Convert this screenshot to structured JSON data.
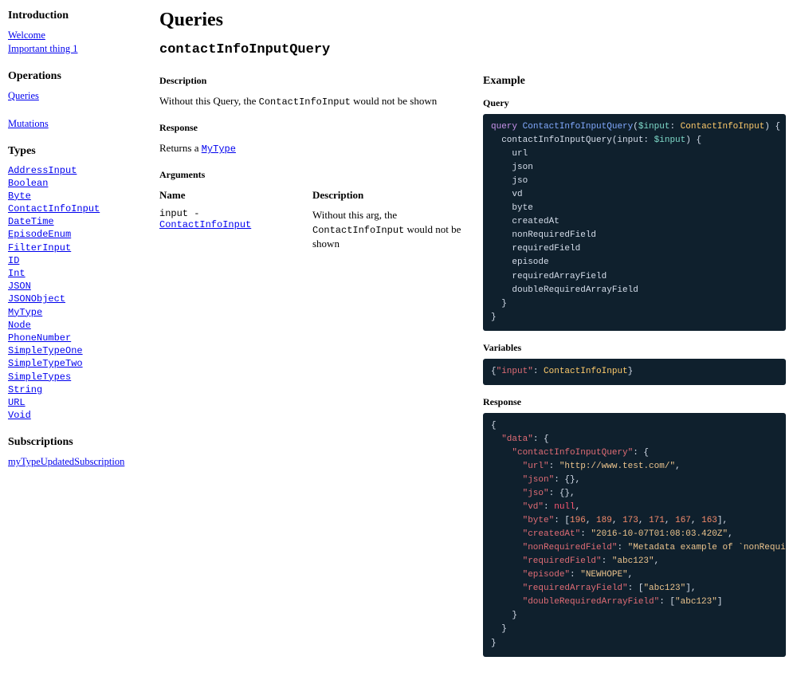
{
  "sidebar": {
    "intro_h": "Introduction",
    "intro_links": [
      "Welcome",
      "Important thing 1"
    ],
    "ops_h": "Operations",
    "ops_links": [
      "Queries",
      "Mutations"
    ],
    "types_h": "Types",
    "types_links": [
      "AddressInput",
      "Boolean",
      "Byte",
      "ContactInfoInput",
      "DateTime",
      "EpisodeEnum",
      "FilterInput",
      "ID",
      "Int",
      "JSON",
      "JSONObject",
      "MyType",
      "Node",
      "PhoneNumber",
      "SimpleTypeOne",
      "SimpleTypeTwo",
      "SimpleTypes",
      "String",
      "URL",
      "Void"
    ],
    "subs_h": "Subscriptions",
    "subs_links": [
      "myTypeUpdatedSubscription"
    ]
  },
  "page": {
    "h1": "Queries",
    "query_name": "contactInfoInputQuery",
    "desc_h": "Description",
    "desc_pre": "Without this Query, the ",
    "desc_code": "ContactInfoInput",
    "desc_post": " would not be shown",
    "resp_h": "Response",
    "resp_pre": "Returns a ",
    "resp_link": "MyType",
    "args_h": "Arguments",
    "args_name_h": "Name",
    "args_desc_h": "Description",
    "arg_name": "input",
    "arg_dash": " - ",
    "arg_type": "ContactInfoInput",
    "arg_desc_pre": "Without this arg, the ",
    "arg_desc_code": "ContactInfoInput",
    "arg_desc_post": " would not be shown",
    "example_h": "Example",
    "query_sub": "Query",
    "vars_sub": "Variables",
    "resp_sub": "Response"
  },
  "code": {
    "query": {
      "kw": "query",
      "fn": "ContactInfoInputQuery",
      "lp": "(",
      "var": "$input",
      "colon": ": ",
      "type": "ContactInfoInput",
      "rp": ") {",
      "l2a": "  contactInfoInputQuery(input: ",
      "l2v": "$input",
      "l2b": ") {",
      "fields": [
        "url",
        "json",
        "jso",
        "vd",
        "byte",
        "createdAt",
        "nonRequiredField",
        "requiredField",
        "episode",
        "requiredArrayField",
        "doubleRequiredArrayField"
      ],
      "close1": "  }",
      "close2": "}"
    },
    "vars": {
      "open": "{",
      "key": "\"input\"",
      "sep": ": ",
      "val": "ContactInfoInput",
      "close": "}"
    },
    "resp": {
      "l1": "{",
      "l2k": "  \"data\"",
      "l2s": ": {",
      "l3k": "    \"contactInfoInputQuery\"",
      "l3s": ": {",
      "l4k": "      \"url\"",
      "l4s": ": ",
      "l4v": "\"http://www.test.com/\"",
      "l4e": ",",
      "l5k": "      \"json\"",
      "l5s": ": {},",
      "l6k": "      \"jso\"",
      "l6s": ": {},",
      "l7k": "      \"vd\"",
      "l7s": ": ",
      "l7v": "null",
      "l7e": ",",
      "l8k": "      \"byte\"",
      "l8s": ": [",
      "l8n1": "196",
      "l8n2": "189",
      "l8n3": "173",
      "l8n4": "171",
      "l8n5": "167",
      "l8n6": "163",
      "l8e": "],",
      "l9k": "      \"createdAt\"",
      "l9s": ": ",
      "l9v": "\"2016-10-07T01:08:03.420Z\"",
      "l9e": ",",
      "l10k": "      \"nonRequiredField\"",
      "l10s": ": ",
      "l10v": "\"Metadata example of `nonRequiredField`\"",
      "l10e": ",",
      "l11k": "      \"requiredField\"",
      "l11s": ": ",
      "l11v": "\"abc123\"",
      "l11e": ",",
      "l12k": "      \"episode\"",
      "l12s": ": ",
      "l12v": "\"NEWHOPE\"",
      "l12e": ",",
      "l13k": "      \"requiredArrayField\"",
      "l13s": ": [",
      "l13v": "\"abc123\"",
      "l13e": "],",
      "l14k": "      \"doubleRequiredArrayField\"",
      "l14s": ": [",
      "l14v": "\"abc123\"",
      "l14e": "]",
      "l15": "    }",
      "l16": "  }",
      "l17": "}"
    }
  }
}
